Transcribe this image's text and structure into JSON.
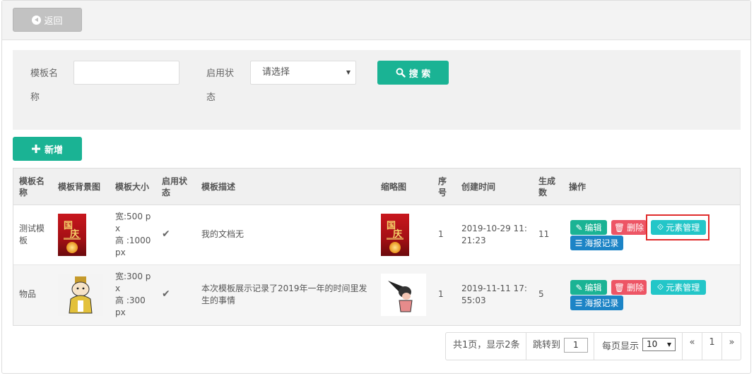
{
  "topbar": {
    "back_label": "返回"
  },
  "search": {
    "name_label": "模板名称",
    "status_label": "启用状态",
    "status_value": "请选择",
    "search_label": "搜 索"
  },
  "actions": {
    "add_label": "新增"
  },
  "table": {
    "headers": {
      "name": "模板名称",
      "bg": "模板背景图",
      "size": "模板大小",
      "status": "启用状态",
      "desc": "模板描述",
      "thumb": "缩略图",
      "order": "序号",
      "created": "创建时间",
      "count": "生成数",
      "ops": "操作"
    },
    "rows": [
      {
        "name": "测试模板",
        "size_w": "宽:500 px",
        "size_h": "高 :1000 px",
        "status_icon": "check-icon",
        "desc": "我的文档无",
        "order": "1",
        "created": "2019-10-29 11:21:23",
        "count": "11",
        "poster_text_1": "国",
        "poster_text_2": "庆"
      },
      {
        "name": "物品",
        "size_w": "宽:300 px",
        "size_h": "高 :300 px",
        "status_icon": "check-icon",
        "desc": "本次模板展示记录了2019年一年的时间里发生的事情",
        "order": "1",
        "created": "2019-11-11 17:55:03",
        "count": "5"
      }
    ],
    "op_labels": {
      "edit": "编辑",
      "delete": "删除",
      "elements": "元素管理",
      "poster": "海报记录"
    }
  },
  "pager": {
    "summary": "共1页，显示2条",
    "jump_label": "跳转到",
    "jump_value": "1",
    "per_page_label": "每页显示",
    "per_page_value": "10",
    "prev": "«",
    "page": "1",
    "next": "»"
  },
  "colors": {
    "primary": "#1ab394",
    "danger": "#ed5565",
    "info": "#23c6c8",
    "secondary": "#1c84c6",
    "highlight": "#e02c2c"
  }
}
